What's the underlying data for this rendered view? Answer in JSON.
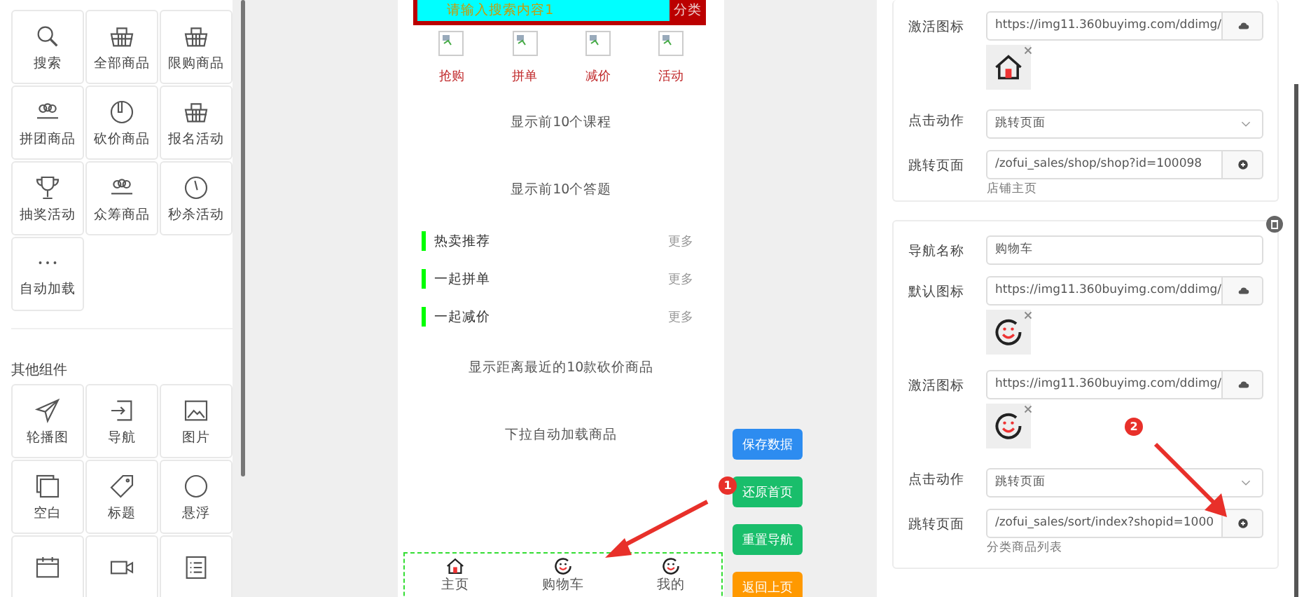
{
  "component_panel": {
    "groups": [
      {
        "items": [
          {
            "label": "搜索"
          },
          {
            "label": "全部商品"
          },
          {
            "label": "限购商品"
          },
          {
            "label": "拼团商品"
          },
          {
            "label": "砍价商品"
          },
          {
            "label": "报名活动"
          },
          {
            "label": "抽奖活动"
          },
          {
            "label": "众筹商品"
          },
          {
            "label": "秒杀活动"
          },
          {
            "label": "自动加载"
          }
        ]
      },
      {
        "title": "其他组件",
        "items": [
          {
            "label": "轮播图"
          },
          {
            "label": "导航"
          },
          {
            "label": "图片"
          },
          {
            "label": "空白"
          },
          {
            "label": "标题"
          },
          {
            "label": "悬浮"
          }
        ]
      }
    ]
  },
  "phone_preview": {
    "search": {
      "placeholder": "请输入搜索内容1",
      "category": "分类"
    },
    "shortcuts": [
      "抢购",
      "拼单",
      "减价",
      "活动"
    ],
    "notes_top": [
      "显示前10个课程",
      "显示前10个答题"
    ],
    "sections": [
      {
        "title": "热卖推荐",
        "more": "更多"
      },
      {
        "title": "一起拼单",
        "more": "更多"
      },
      {
        "title": "一起减价",
        "more": "更多"
      }
    ],
    "notes_bottom": [
      "显示距离最近的10款砍价商品",
      "下拉自动加载商品"
    ],
    "bottom_nav": [
      {
        "label": "主页"
      },
      {
        "label": "购物车"
      },
      {
        "label": "我的"
      }
    ]
  },
  "action_buttons": [
    {
      "label": "保存数据",
      "color": "#2d8cf0"
    },
    {
      "label": "还原首页",
      "color": "#19be6b"
    },
    {
      "label": "重置导航",
      "color": "#19be6b"
    },
    {
      "label": "返回上页",
      "color": "#ff9900"
    }
  ],
  "nav_settings": [
    {
      "deletable": false,
      "fields": [
        {
          "kind": "upload",
          "label": "激活图标",
          "value": "https://img11.360buyimg.com/ddimg/"
        },
        {
          "kind": "select",
          "label": "点击动作",
          "value": "跳转页面"
        },
        {
          "kind": "link",
          "label": "跳转页面",
          "value": "/zofui_sales/shop/shop?id=100098",
          "hint": "店铺主页"
        }
      ]
    },
    {
      "deletable": true,
      "fields": [
        {
          "kind": "text",
          "label": "导航名称",
          "value": "购物车"
        },
        {
          "kind": "upload",
          "label": "默认图标",
          "value": "https://img11.360buyimg.com/ddimg/"
        },
        {
          "kind": "upload",
          "label": "激活图标",
          "value": "https://img11.360buyimg.com/ddimg/"
        },
        {
          "kind": "select",
          "label": "点击动作",
          "value": "跳转页面"
        },
        {
          "kind": "link",
          "label": "跳转页面",
          "value": "/zofui_sales/sort/index?shopid=1000",
          "hint": "分类商品列表"
        }
      ]
    }
  ],
  "annotations": [
    {
      "number": "1"
    },
    {
      "number": "2"
    }
  ]
}
